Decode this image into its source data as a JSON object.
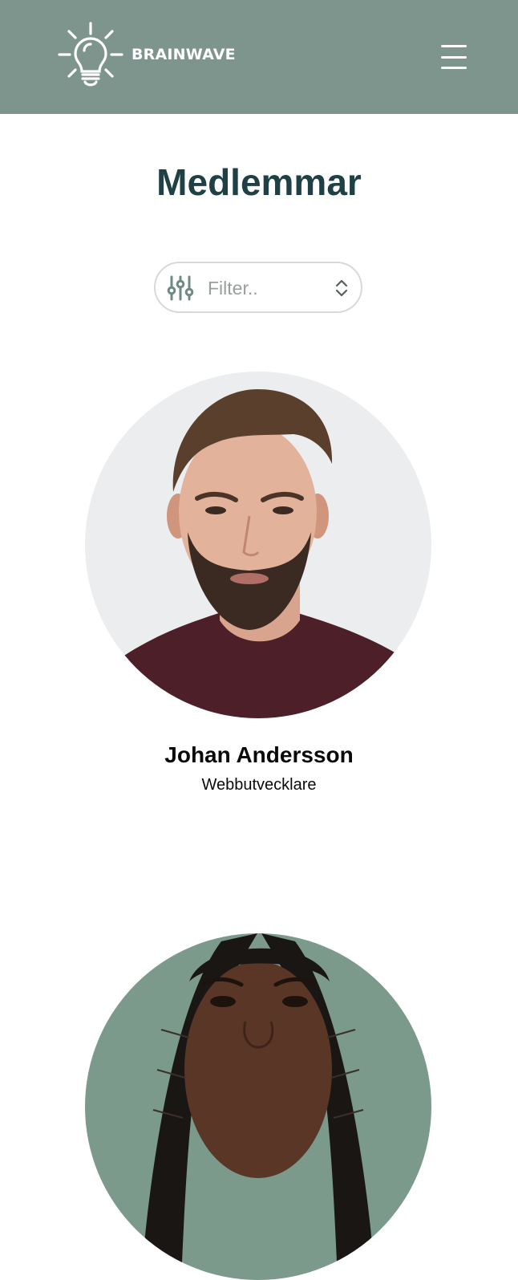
{
  "header": {
    "brand": "BRAINWAVE",
    "logo_icon": "lightbulb-icon",
    "menu_icon": "hamburger-menu-icon",
    "background_color": "#7e958e"
  },
  "main": {
    "title": "Medlemmar",
    "filter": {
      "placeholder": "Filter..",
      "icon": "sliders-icon",
      "chevron_icon": "chevron-up-down-icon"
    },
    "members": [
      {
        "name": "Johan Andersson",
        "role": "Webbutvecklare"
      },
      {
        "name": "",
        "role": ""
      }
    ]
  }
}
